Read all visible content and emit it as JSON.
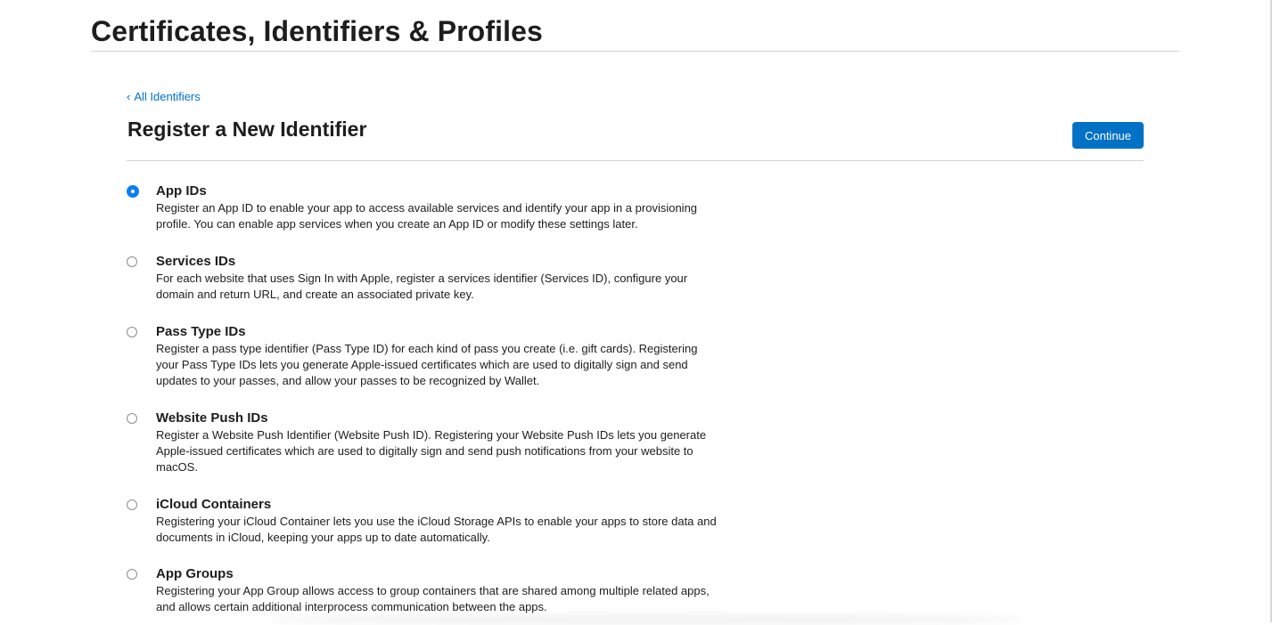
{
  "header": {
    "title": "Certificates, Identifiers & Profiles"
  },
  "nav": {
    "back_chevron": "‹",
    "back_label": "All Identifiers"
  },
  "section": {
    "title": "Register a New Identifier",
    "continue_label": "Continue"
  },
  "options": [
    {
      "title": "App IDs",
      "selected": true,
      "lines": [
        "Register an App ID to enable your app to access available services and identify your app in a provisioning",
        "profile. You can enable app services when you create an App ID or modify these settings later."
      ]
    },
    {
      "title": "Services IDs",
      "selected": false,
      "lines": [
        "For each website that uses Sign In with Apple, register a services identifier (Services ID), configure your",
        "domain and return URL, and create an associated private key."
      ]
    },
    {
      "title": "Pass Type IDs",
      "selected": false,
      "lines": [
        "Register a pass type identifier (Pass Type ID) for each kind of pass you create (i.e. gift cards). Registering",
        "your Pass Type IDs lets you generate Apple-issued certificates which are used to digitally sign and send",
        "updates to your passes, and allow your passes to be recognized by Wallet."
      ]
    },
    {
      "title": "Website Push IDs",
      "selected": false,
      "lines": [
        "Register a Website Push Identifier (Website Push ID). Registering your Website Push IDs lets you generate",
        "Apple-issued certificates which are used to digitally sign and send push notifications from your website to",
        "macOS."
      ]
    },
    {
      "title": "iCloud Containers",
      "selected": false,
      "lines": [
        "Registering your iCloud Container lets you use the iCloud Storage APIs to enable your apps to store data and",
        "documents in iCloud, keeping your apps up to date automatically."
      ]
    },
    {
      "title": "App Groups",
      "selected": false,
      "lines": [
        "Registering your App Group allows access to group containers that are shared among multiple related apps,",
        "and allows certain additional interprocess communication between the apps."
      ]
    }
  ],
  "colors": {
    "accent": "#0071c5",
    "link": "#0070c9",
    "radio_selected": "#0a7ff5"
  }
}
